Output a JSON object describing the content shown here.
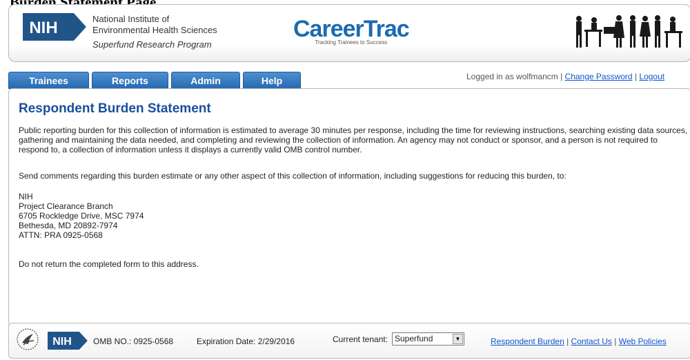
{
  "cut_heading": "Burden Statement Page",
  "header": {
    "nih_logo_text": "NIH",
    "org_line1": "National Institute of",
    "org_line2": "Environmental Health Sciences",
    "org_program": "Superfund Research Program",
    "brand_title": "CareerTrac",
    "brand_tagline": "Tracking Trainees to Success"
  },
  "nav": {
    "tabs": [
      {
        "label": "Trainees"
      },
      {
        "label": "Reports"
      },
      {
        "label": "Admin"
      },
      {
        "label": "Help"
      }
    ],
    "tab_color": "#2f74bd"
  },
  "login": {
    "prefix": "Logged in as wolfmancm",
    "separator": " | ",
    "change_password": "Change Password",
    "logout": "Logout"
  },
  "content": {
    "title": "Respondent Burden Statement",
    "paragraph1": "Public reporting burden for this collection of information is estimated to average 30 minutes per response, including the time for reviewing instructions, searching existing data sources, gathering and maintaining the data needed, and completing and reviewing the collection of information. An agency may not conduct or sponsor, and a person is not required to respond to, a collection of information unless it displays a currently valid OMB control number.",
    "paragraph2": "Send comments regarding this burden estimate or any other aspect of this collection of information, including suggestions for reducing this burden, to:",
    "address": [
      "NIH",
      "Project Clearance Branch",
      "6705 Rockledge Drive, MSC 7974",
      "Bethesda, MD 20892-7974",
      "ATTN: PRA 0925-0568"
    ],
    "paragraph3": "Do not return the completed form to this address."
  },
  "footer": {
    "nih_logo_text": "NIH",
    "omb": "OMB NO.: 0925-0568",
    "expiration": "Expiration Date: 2/29/2016",
    "tenant_label": "Current tenant:",
    "tenant_value": "Superfund",
    "link_burden": "Respondent Burden",
    "link_contact": "Contact Us",
    "link_policies": "Web Policies",
    "separator": " | "
  },
  "colors": {
    "brand_blue": "#1c6bb0",
    "title_blue": "#1a4f9c",
    "link_blue": "#1155cc",
    "nih_blue": "#20558a"
  }
}
